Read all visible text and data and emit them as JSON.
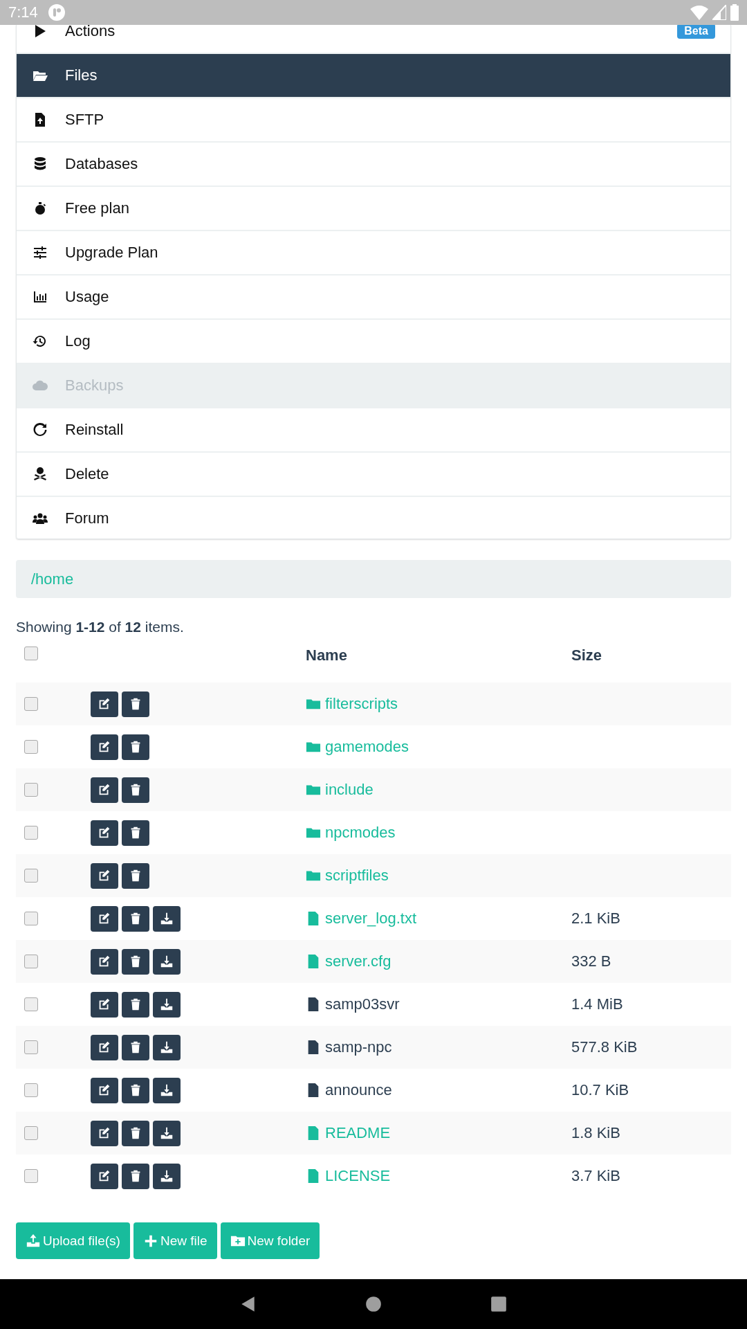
{
  "status_bar": {
    "time": "7:14"
  },
  "menu": [
    {
      "label": "Actions",
      "selected": false,
      "disabled": false,
      "badge": "Beta"
    },
    {
      "label": "Files",
      "selected": true,
      "disabled": false
    },
    {
      "label": "SFTP",
      "selected": false,
      "disabled": false
    },
    {
      "label": "Databases",
      "selected": false,
      "disabled": false
    },
    {
      "label": "Free plan",
      "selected": false,
      "disabled": false
    },
    {
      "label": "Upgrade Plan",
      "selected": false,
      "disabled": false
    },
    {
      "label": "Usage",
      "selected": false,
      "disabled": false
    },
    {
      "label": "Log",
      "selected": false,
      "disabled": false
    },
    {
      "label": "Backups",
      "selected": false,
      "disabled": true
    },
    {
      "label": "Reinstall",
      "selected": false,
      "disabled": false
    },
    {
      "label": "Delete",
      "selected": false,
      "disabled": false
    },
    {
      "label": "Forum",
      "selected": false,
      "disabled": false
    }
  ],
  "breadcrumb": "/home",
  "summary": "Showing **1-12** of **12** items.",
  "table": {
    "columns": [
      "Name",
      "Size"
    ],
    "select_all": {
      "checked": false
    },
    "rows": [
      {
        "kind": "folder",
        "name": "filterscripts",
        "checked": false
      },
      {
        "kind": "folder",
        "name": "gamemodes",
        "checked": false
      },
      {
        "kind": "folder",
        "name": "include",
        "checked": false
      },
      {
        "kind": "folder",
        "name": "npcmodes",
        "checked": false
      },
      {
        "kind": "folder",
        "name": "scriptfiles",
        "checked": false
      },
      {
        "kind": "text",
        "name": "server_log.txt",
        "size": "2.1 KiB",
        "checked": false
      },
      {
        "kind": "text",
        "name": "server.cfg",
        "size": "332 B",
        "checked": false
      },
      {
        "kind": "binary",
        "name": "samp03svr",
        "size": "1.4 MiB",
        "checked": false
      },
      {
        "kind": "binary",
        "name": "samp-npc",
        "size": "577.8 KiB",
        "checked": false
      },
      {
        "kind": "binary",
        "name": "announce",
        "size": "10.7 KiB",
        "checked": false
      },
      {
        "kind": "text",
        "name": "README",
        "size": "1.8 KiB",
        "checked": false
      },
      {
        "kind": "text",
        "name": "LICENSE",
        "size": "3.7 KiB",
        "checked": false
      }
    ]
  },
  "buttons": [
    {
      "label": "Upload file(s)"
    },
    {
      "label": "New file"
    },
    {
      "label": "New folder"
    }
  ]
}
